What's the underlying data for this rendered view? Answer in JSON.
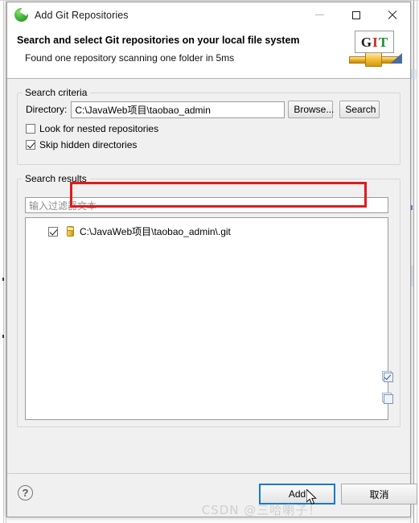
{
  "window": {
    "title": "Add Git Repositories",
    "app_icon": "eclipse-icon",
    "minimize_label": "Minimize",
    "maximize_label": "Maximize",
    "close_label": "Close"
  },
  "header": {
    "title": "Search and select Git repositories on your local file system",
    "subtitle": "Found one repository scanning one folder in 5ms",
    "logo": {
      "letter_g": "G",
      "letter_i": "I",
      "letter_t": "T",
      "g_color": "#1d1d1d",
      "i_color": "#cf2222",
      "t_color": "#1a8f2b"
    }
  },
  "search_criteria": {
    "legend": "Search criteria",
    "directory_label": "Directory:",
    "directory_value": "C:\\JavaWeb项目\\taobao_admin",
    "browse_label": "Browse...",
    "search_label": "Search",
    "nested_label": "Look for nested repositories",
    "nested_checked": false,
    "skip_hidden_label": "Skip hidden directories",
    "skip_hidden_checked": true,
    "highlight_color": "#e01b1b"
  },
  "search_results": {
    "legend": "Search results",
    "filter_placeholder": "输入过滤器文本",
    "filter_value": "输入过滤器文本",
    "items": [
      {
        "label": "C:\\JavaWeb项目\\taobao_admin\\.git",
        "checked": true,
        "icon": "repository-icon"
      }
    ],
    "select_all_label": "Select All",
    "deselect_all_label": "Deselect All"
  },
  "footer": {
    "help_label": "?",
    "add_label": "Add",
    "cancel_label": "取消",
    "focus_color": "#1a7ac6"
  },
  "watermark": {
    "text": "CSDN @三哈喇子！"
  }
}
